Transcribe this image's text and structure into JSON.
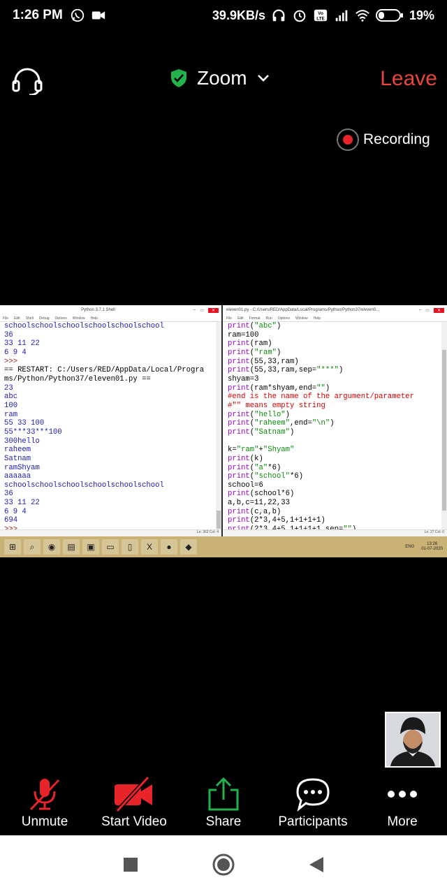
{
  "status_bar": {
    "time": "1:26 PM",
    "speed": "39.9KB/s",
    "battery": "19%",
    "icons": [
      "whatsapp-icon",
      "video-call-icon",
      "headphones-icon",
      "alarm-icon",
      "volte-icon",
      "signal-icon",
      "wifi-icon",
      "battery-icon"
    ]
  },
  "meeting": {
    "app_name": "Zoom",
    "leave_label": "Leave",
    "recording_label": "Recording",
    "colors": {
      "leave": "#e8453c",
      "shield": "#23b24b",
      "mute": "#e8242b"
    }
  },
  "shared_screen": {
    "shell": {
      "title": "Python 3.7.1 Shell",
      "menu": [
        "File",
        "Edit",
        "Shell",
        "Debug",
        "Options",
        "Window",
        "Help"
      ],
      "lines": [
        {
          "t": "schoolschoolschoolschoolschoolschool",
          "c": "out"
        },
        {
          "t": "36",
          "c": "out"
        },
        {
          "t": "33 11 22",
          "c": "out"
        },
        {
          "t": "6 9 4",
          "c": "out"
        },
        {
          "t": ">>>",
          "c": "prompt"
        },
        {
          "t": "== RESTART: C:/Users/RED/AppData/Local/Progra",
          "c": "plain"
        },
        {
          "t": "ms/Python/Python37/eleven01.py ==",
          "c": "plain"
        },
        {
          "t": "23",
          "c": "out"
        },
        {
          "t": "abc",
          "c": "out"
        },
        {
          "t": "100",
          "c": "out"
        },
        {
          "t": "ram",
          "c": "out"
        },
        {
          "t": "55 33 100",
          "c": "out"
        },
        {
          "t": "55***33***100",
          "c": "out"
        },
        {
          "t": "300hello",
          "c": "out"
        },
        {
          "t": "raheem",
          "c": "out"
        },
        {
          "t": "Satnam",
          "c": "out"
        },
        {
          "t": "ramShyam",
          "c": "out"
        },
        {
          "t": "aaaaaa",
          "c": "out"
        },
        {
          "t": "schoolschoolschoolschoolschoolschool",
          "c": "out"
        },
        {
          "t": "36",
          "c": "out"
        },
        {
          "t": "33 11 22",
          "c": "out"
        },
        {
          "t": "6 9 4",
          "c": "out"
        },
        {
          "t": "694",
          "c": "out"
        },
        {
          "t": ">>>",
          "c": "prompt"
        }
      ],
      "status": "Ln: 362  Col: 4"
    },
    "editor": {
      "title": "eleven01.py - C:/Users/RED/AppData/Local/Programs/Python/Python37/eleven0...",
      "menu": [
        "File",
        "Edit",
        "Format",
        "Run",
        "Options",
        "Window",
        "Help"
      ],
      "lines": [
        [
          {
            "t": "print",
            "c": "kw"
          },
          {
            "t": "(",
            "c": "plain"
          },
          {
            "t": "\"abc\"",
            "c": "str"
          },
          {
            "t": ")",
            "c": "plain"
          }
        ],
        [
          {
            "t": "ram=100",
            "c": "plain"
          }
        ],
        [
          {
            "t": "print",
            "c": "kw"
          },
          {
            "t": "(ram)",
            "c": "plain"
          }
        ],
        [
          {
            "t": "print",
            "c": "kw"
          },
          {
            "t": "(",
            "c": "plain"
          },
          {
            "t": "\"ram\"",
            "c": "str"
          },
          {
            "t": ")",
            "c": "plain"
          }
        ],
        [
          {
            "t": "print",
            "c": "kw"
          },
          {
            "t": "(55,33,ram)",
            "c": "plain"
          }
        ],
        [
          {
            "t": "print",
            "c": "kw"
          },
          {
            "t": "(55,33,ram,sep=",
            "c": "plain"
          },
          {
            "t": "\"***\"",
            "c": "str"
          },
          {
            "t": ")",
            "c": "plain"
          }
        ],
        [
          {
            "t": "shyam=3",
            "c": "plain"
          }
        ],
        [
          {
            "t": "print",
            "c": "kw"
          },
          {
            "t": "(ram*shyam,end=",
            "c": "plain"
          },
          {
            "t": "\"\"",
            "c": "str"
          },
          {
            "t": ")",
            "c": "plain"
          }
        ],
        [
          {
            "t": "#end is the name of the argument/parameter",
            "c": "com"
          }
        ],
        [
          {
            "t": "#\"\" means empty string",
            "c": "com"
          }
        ],
        [
          {
            "t": "print",
            "c": "kw"
          },
          {
            "t": "(",
            "c": "plain"
          },
          {
            "t": "\"hello\"",
            "c": "str"
          },
          {
            "t": ")",
            "c": "plain"
          }
        ],
        [
          {
            "t": "print",
            "c": "kw"
          },
          {
            "t": "(",
            "c": "plain"
          },
          {
            "t": "\"raheem\"",
            "c": "str"
          },
          {
            "t": ",end=",
            "c": "plain"
          },
          {
            "t": "\"\\n\"",
            "c": "str"
          },
          {
            "t": ")",
            "c": "plain"
          }
        ],
        [
          {
            "t": "print",
            "c": "kw"
          },
          {
            "t": "(",
            "c": "plain"
          },
          {
            "t": "\"Satnam\"",
            "c": "str"
          },
          {
            "t": ")",
            "c": "plain"
          }
        ],
        [
          {
            "t": "",
            "c": "plain"
          }
        ],
        [
          {
            "t": "k=",
            "c": "plain"
          },
          {
            "t": "\"ram\"",
            "c": "str"
          },
          {
            "t": "+",
            "c": "plain"
          },
          {
            "t": "\"Shyam\"",
            "c": "str"
          }
        ],
        [
          {
            "t": "print",
            "c": "kw"
          },
          {
            "t": "(k)",
            "c": "plain"
          }
        ],
        [
          {
            "t": "print",
            "c": "kw"
          },
          {
            "t": "(",
            "c": "plain"
          },
          {
            "t": "\"a\"",
            "c": "str"
          },
          {
            "t": "*6)",
            "c": "plain"
          }
        ],
        [
          {
            "t": "print",
            "c": "kw"
          },
          {
            "t": "(",
            "c": "plain"
          },
          {
            "t": "\"school\"",
            "c": "str"
          },
          {
            "t": "*6)",
            "c": "plain"
          }
        ],
        [
          {
            "t": "school=6",
            "c": "plain"
          }
        ],
        [
          {
            "t": "print",
            "c": "kw"
          },
          {
            "t": "(school*6)",
            "c": "plain"
          }
        ],
        [
          {
            "t": "a,b,c=11,22,33",
            "c": "plain"
          }
        ],
        [
          {
            "t": "print",
            "c": "kw"
          },
          {
            "t": "(c,a,b)",
            "c": "plain"
          }
        ],
        [
          {
            "t": "print",
            "c": "kw"
          },
          {
            "t": "(2*3,4+5,1+1+1+1)",
            "c": "plain"
          }
        ],
        [
          {
            "t": "print",
            "c": "kw"
          },
          {
            "t": "(2*3,4+5,1+1+1+1,sep=",
            "c": "plain"
          },
          {
            "t": "\"\"",
            "c": "str"
          },
          {
            "t": ")",
            "c": "plain"
          }
        ]
      ],
      "status": "Ln: 27  Col: 0"
    },
    "taskbar": {
      "tray_lang": "ENG",
      "tray_time": "13:26",
      "tray_date": "01-07-2020"
    }
  },
  "controls": [
    {
      "id": "unmute",
      "label": "Unmute",
      "icon": "mic-muted-icon"
    },
    {
      "id": "start-video",
      "label": "Start Video",
      "icon": "video-off-icon"
    },
    {
      "id": "share",
      "label": "Share",
      "icon": "share-icon"
    },
    {
      "id": "participants",
      "label": "Participants",
      "icon": "chat-bubble-icon"
    },
    {
      "id": "more",
      "label": "More",
      "icon": "more-dots-icon"
    }
  ],
  "navbar": {
    "icons": [
      "recents-square-icon",
      "home-circle-icon",
      "back-triangle-icon"
    ]
  }
}
